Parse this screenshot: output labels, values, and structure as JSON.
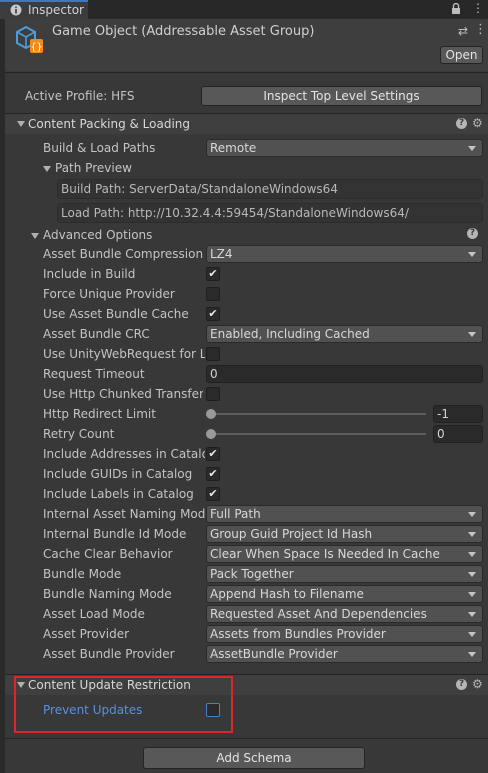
{
  "tab": {
    "title": "Inspector"
  },
  "header": {
    "title": "Game Object (Addressable Asset Group)",
    "open_label": "Open"
  },
  "profile": {
    "label": "Active Profile: HFS",
    "button": "Inspect Top Level Settings"
  },
  "content_packing": {
    "title": "Content Packing & Loading",
    "build_load_paths": {
      "label": "Build & Load Paths",
      "value": "Remote"
    },
    "path_preview": {
      "title": "Path Preview",
      "build_path": "Build Path: ServerData/StandaloneWindows64",
      "load_path": "Load Path: http://10.32.4.4:59454/StandaloneWindows64/"
    },
    "advanced": {
      "title": "Advanced Options",
      "compression": {
        "label": "Asset Bundle Compression",
        "value": "LZ4"
      },
      "include_in_build": {
        "label": "Include in Build",
        "checked": true
      },
      "force_unique_provider": {
        "label": "Force Unique Provider",
        "checked": false
      },
      "use_bundle_cache": {
        "label": "Use Asset Bundle Cache",
        "checked": true
      },
      "bundle_crc": {
        "label": "Asset Bundle CRC",
        "value": "Enabled, Including Cached"
      },
      "use_uwr": {
        "label": "Use UnityWebRequest for Lo",
        "checked": false
      },
      "request_timeout": {
        "label": "Request Timeout",
        "value": "0"
      },
      "chunked_transfer": {
        "label": "Use Http Chunked Transfer",
        "checked": false
      },
      "redirect_limit": {
        "label": "Http Redirect Limit",
        "value": "-1"
      },
      "retry_count": {
        "label": "Retry Count",
        "value": "0"
      },
      "include_addresses": {
        "label": "Include Addresses in Catalog",
        "checked": true
      },
      "include_guids": {
        "label": "Include GUIDs in Catalog",
        "checked": true
      },
      "include_labels": {
        "label": "Include Labels in Catalog",
        "checked": true
      },
      "naming_mode": {
        "label": "Internal Asset Naming Mode",
        "value": "Full Path"
      },
      "bundle_id_mode": {
        "label": "Internal Bundle Id Mode",
        "value": "Group Guid Project Id Hash"
      },
      "cache_clear": {
        "label": "Cache Clear Behavior",
        "value": "Clear When Space Is Needed In Cache"
      },
      "bundle_mode": {
        "label": "Bundle Mode",
        "value": "Pack Together"
      },
      "bundle_naming": {
        "label": "Bundle Naming Mode",
        "value": "Append Hash to Filename"
      },
      "load_mode": {
        "label": "Asset Load Mode",
        "value": "Requested Asset And Dependencies"
      },
      "asset_provider": {
        "label": "Asset Provider",
        "value": "Assets from Bundles Provider"
      },
      "bundle_provider": {
        "label": "Asset Bundle Provider",
        "value": "AssetBundle Provider"
      }
    }
  },
  "content_update": {
    "title": "Content Update Restriction",
    "prevent_updates": {
      "label": "Prevent Updates",
      "checked": false
    }
  },
  "add_schema": "Add Schema",
  "colors": {
    "highlight": "#e0242e",
    "accent": "#3a79bb",
    "link_label": "#5b8fde"
  }
}
